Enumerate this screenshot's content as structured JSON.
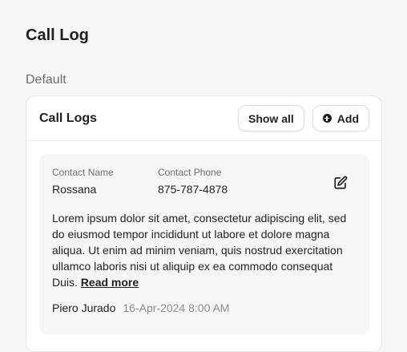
{
  "page": {
    "title": "Call Log",
    "section_label": "Default"
  },
  "card": {
    "title": "Call Logs",
    "show_all_label": "Show all",
    "add_label": "Add"
  },
  "log": {
    "contact_name_label": "Contact Name",
    "contact_name": "Rossana",
    "contact_phone_label": "Contact Phone",
    "contact_phone": "875-787-4878",
    "description": "Lorem ipsum dolor sit amet, consectetur adipiscing elit, sed do eiusmod tempor incididunt ut labore et dolore magna aliqua. Ut enim ad minim veniam, quis nostrud exercitation ullamco laboris nisi ut aliquip ex ea commodo consequat Duis.",
    "read_more_label": "Read more",
    "author": "Piero Jurado",
    "timestamp": "16-Apr-2024 8:00 AM"
  },
  "icons": {
    "add": "plus-circle-icon",
    "edit": "edit-icon"
  }
}
